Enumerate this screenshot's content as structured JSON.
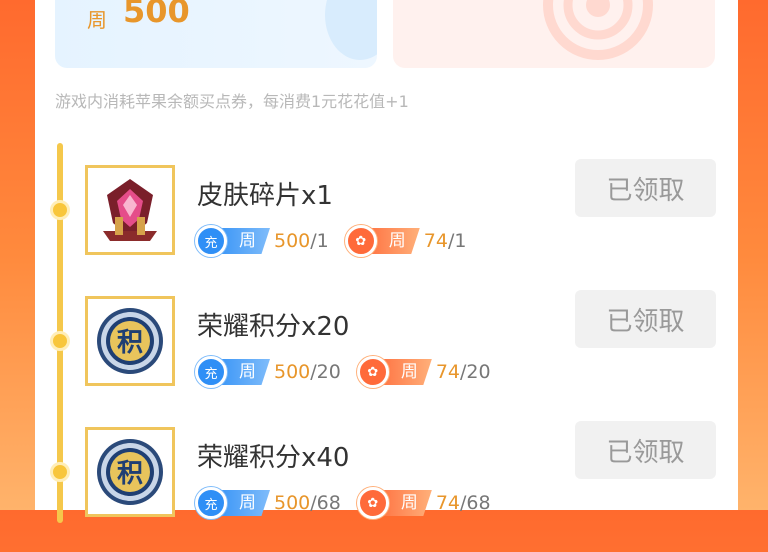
{
  "summary": {
    "week_prefix": "周",
    "week_value": "500"
  },
  "note": "游戏内消耗苹果余额买点券，每消费1元花花值+1",
  "pill_text": {
    "charge_circle": "充",
    "week_label": "周",
    "flower_circle": "✿"
  },
  "colors": {
    "accent": "#e8962b",
    "blue": "#2f8ff6",
    "orange": "#ff6a3a",
    "timeline": "#f5c84b"
  },
  "items": [
    {
      "name": "皮肤碎片x1",
      "icon": "skin-shard-icon",
      "charge_current": "500",
      "charge_target": "/1",
      "flower_current": "74",
      "flower_target": "/1",
      "status": "已领取"
    },
    {
      "name": "荣耀积分x20",
      "icon": "honor-points-icon",
      "charge_current": "500",
      "charge_target": "/20",
      "flower_current": "74",
      "flower_target": "/20",
      "status": "已领取"
    },
    {
      "name": "荣耀积分x40",
      "icon": "honor-points-icon",
      "charge_current": "500",
      "charge_target": "/68",
      "flower_current": "74",
      "flower_target": "/68",
      "status": "已领取"
    }
  ]
}
